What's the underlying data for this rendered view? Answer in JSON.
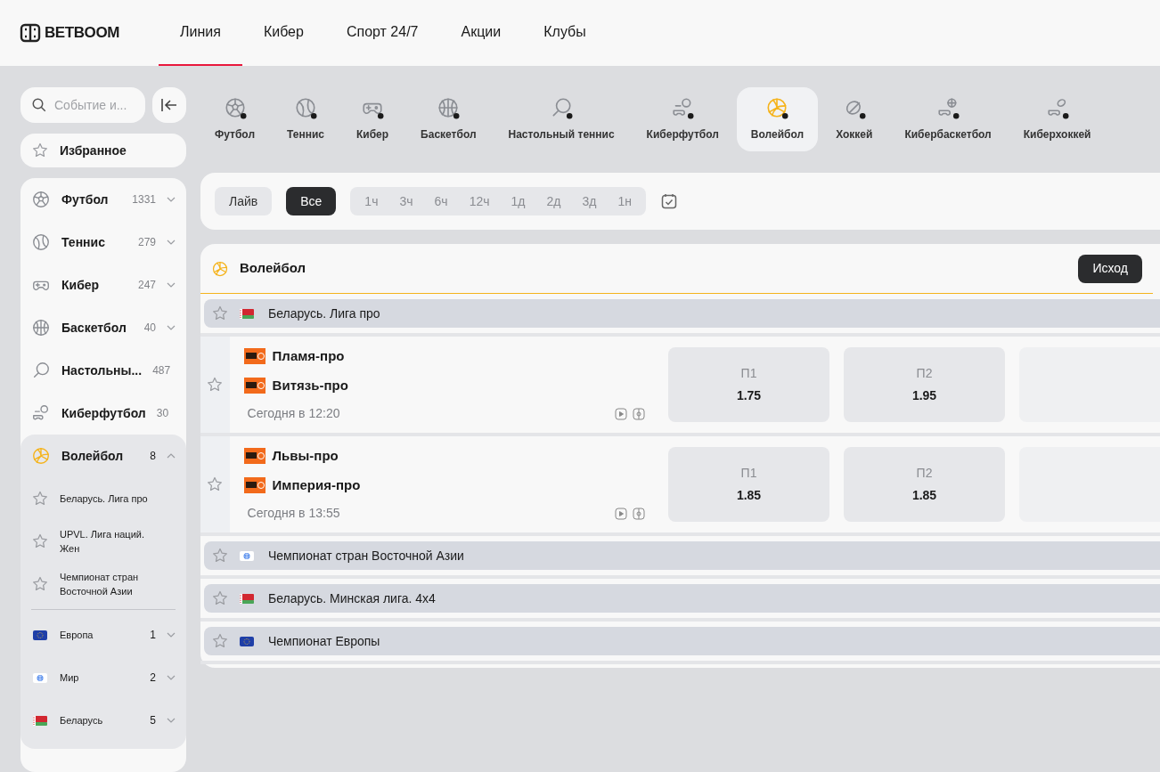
{
  "header": {
    "logo": "BETBOOM",
    "nav": [
      {
        "label": "Линия",
        "selected": true
      },
      {
        "label": "Кибер",
        "selected": false
      },
      {
        "label": "Спорт 24/7",
        "selected": false
      },
      {
        "label": "Акции",
        "selected": false
      },
      {
        "label": "Клубы",
        "selected": false
      }
    ]
  },
  "sidebar": {
    "search": {
      "placeholder": "Событие и..."
    },
    "favorites": "Избранное",
    "sports": [
      {
        "kind": "football",
        "label": "Футбол",
        "count": "1331",
        "expanded": false
      },
      {
        "kind": "tennis",
        "label": "Теннис",
        "count": "279",
        "expanded": false
      },
      {
        "kind": "cyber",
        "label": "Кибер",
        "count": "247",
        "expanded": false
      },
      {
        "kind": "basketball",
        "label": "Баскетбол",
        "count": "40",
        "expanded": false
      },
      {
        "kind": "table-tennis",
        "label": "Настольны...",
        "count": "487",
        "expanded": false
      },
      {
        "kind": "cyber-football",
        "label": "Киберфутбол",
        "count": "30",
        "expanded": false
      },
      {
        "kind": "volleyball",
        "label": "Волейбол",
        "count": "8",
        "expanded": true,
        "leagues": [
          {
            "label": "Беларусь. Лига про"
          },
          {
            "label": "UPVL. Лига наций. Жен"
          },
          {
            "label": "Чемпионат стран Восточной Азии"
          }
        ],
        "countries": [
          {
            "kind": "eu",
            "label": "Европа",
            "count": "1"
          },
          {
            "kind": "world",
            "label": "Мир",
            "count": "2"
          },
          {
            "kind": "by",
            "label": "Беларусь",
            "count": "5"
          }
        ]
      }
    ]
  },
  "sport_tabs": [
    {
      "kind": "football",
      "label": "Футбол",
      "selected": false
    },
    {
      "kind": "tennis",
      "label": "Теннис",
      "selected": false
    },
    {
      "kind": "cyber",
      "label": "Кибер",
      "selected": false
    },
    {
      "kind": "basketball",
      "label": "Баскетбол",
      "selected": false
    },
    {
      "kind": "table-tennis",
      "label": "Настольный теннис",
      "selected": false
    },
    {
      "kind": "cyber-football",
      "label": "Киберфутбол",
      "selected": false
    },
    {
      "kind": "volleyball",
      "label": "Волейбол",
      "selected": true
    },
    {
      "kind": "hockey",
      "label": "Хоккей",
      "selected": false
    },
    {
      "kind": "cyber-basketball",
      "label": "Кибербаскетбол",
      "selected": false
    },
    {
      "kind": "cyber-hockey",
      "label": "Киберхоккей",
      "selected": false
    }
  ],
  "filters": {
    "modes": [
      {
        "label": "Лайв",
        "selected": false
      },
      {
        "label": "Все",
        "selected": true
      }
    ],
    "periods": [
      {
        "label": "1ч",
        "selected": false
      },
      {
        "label": "3ч",
        "selected": false
      },
      {
        "label": "6ч",
        "selected": false
      },
      {
        "label": "12ч",
        "selected": false
      },
      {
        "label": "1д",
        "selected": false
      },
      {
        "label": "2д",
        "selected": false
      },
      {
        "label": "3д",
        "selected": false
      },
      {
        "label": "1н",
        "selected": false
      }
    ]
  },
  "events": {
    "title": "Волейбол",
    "market": "Исход",
    "leagues": [
      {
        "kind": "by",
        "name": "Беларусь. Лига про",
        "matches": [
          {
            "team1": "Пламя-про",
            "team2": "Витязь-про",
            "time": "Сегодня в 12:20",
            "odds": [
              {
                "label": "П1",
                "value": "1.75"
              },
              {
                "label": "П2",
                "value": "1.95"
              }
            ]
          },
          {
            "team1": "Львы-про",
            "team2": "Империя-про",
            "time": "Сегодня в 13:55",
            "odds": [
              {
                "label": "П1",
                "value": "1.85"
              },
              {
                "label": "П2",
                "value": "1.85"
              }
            ]
          }
        ]
      },
      {
        "kind": "world",
        "name": "Чемпионат стран Восточной Азии"
      },
      {
        "kind": "by",
        "name": "Беларусь. Минская лига. 4х4"
      },
      {
        "kind": "eu",
        "name": "Чемпионат Европы"
      }
    ]
  }
}
